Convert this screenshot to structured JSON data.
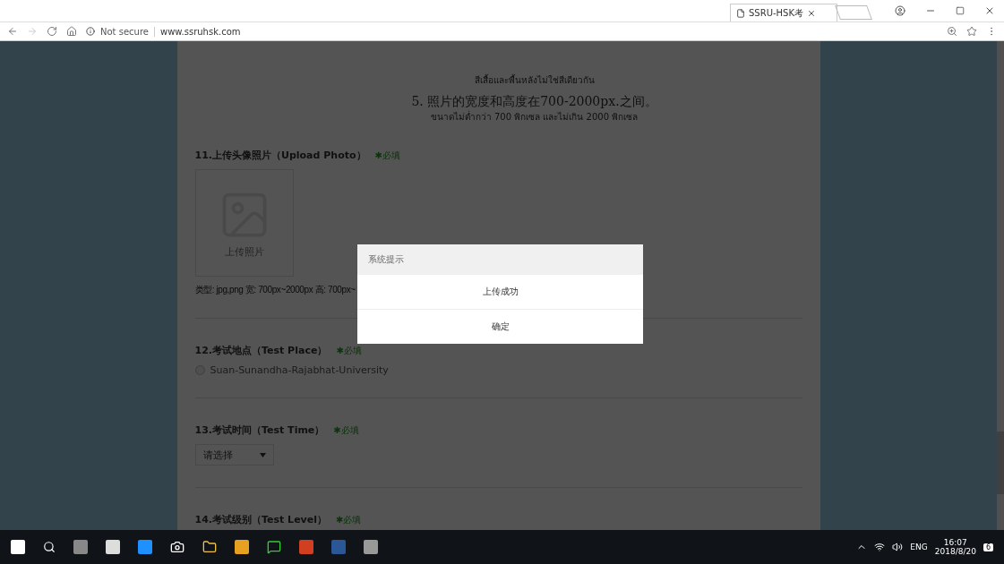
{
  "browser": {
    "tab_title": "SSRU-HSK考",
    "security": "Not secure",
    "url": "www.ssruhsk.com"
  },
  "rules": [
    {
      "main": "5. 照片的宽度和高度在700-2000px.之间。",
      "sub": "ขนาดไม่ต่ำกว่า 700 พิกเซล และไม่เกิน 2000 พิกเซล"
    }
  ],
  "rules_top_sub": "สีเสื้อและพื้นหลังไม่ใช่สีเดียวกัน",
  "sections": [
    {
      "kind": "upload",
      "title": "11.上传头像照片（Upload Photo）",
      "required": "✱必填",
      "upload_label": "上传照片",
      "hint": "类型: jpg,png 宽: 700px~2000px 高: 700px~"
    },
    {
      "kind": "radio",
      "title": "12.考试地点（Test Place）",
      "required": "✱必填",
      "options": [
        {
          "label": "Suan-Sunandha-Rajabhat-University",
          "selected": false
        }
      ]
    },
    {
      "kind": "select",
      "title": "13.考试时间（Test Time）",
      "required": "✱必填",
      "value": "请选择"
    },
    {
      "kind": "heading",
      "title": "14.考试级别（Test Level）",
      "required": "✱必填"
    }
  ],
  "dialog": {
    "title": "系统提示",
    "message": "上传成功",
    "button": "确定"
  },
  "taskbar": {
    "language": "ENG",
    "time": "16:07",
    "date": "2018/8/20",
    "notifications": "6"
  }
}
